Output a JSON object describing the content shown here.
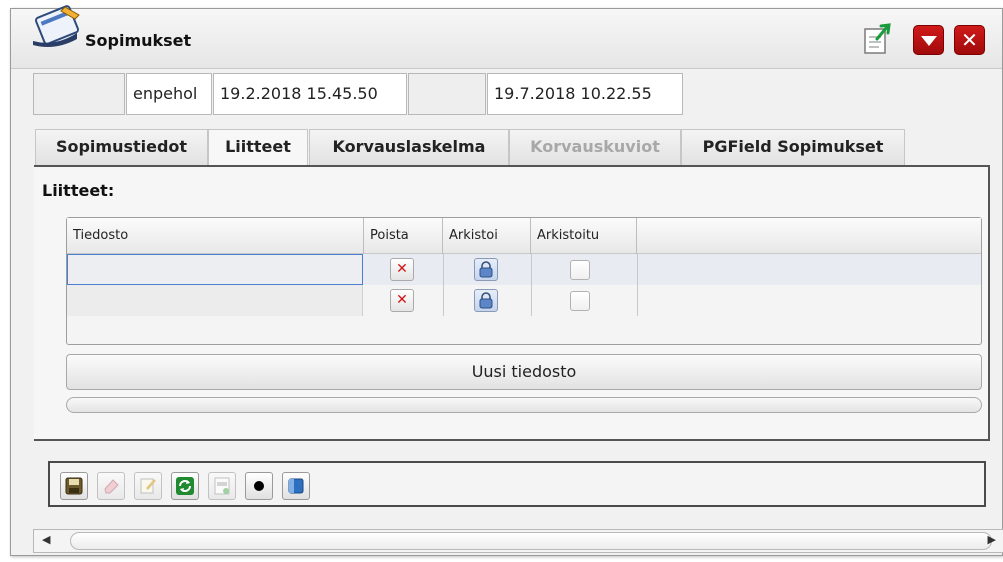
{
  "window": {
    "title": "Sopimukset"
  },
  "header": {
    "user": "enpehol",
    "created": "19.2.2018 15.45.50",
    "modified": "19.7.2018 10.22.55"
  },
  "tabs": [
    {
      "label": "Sopimustiedot",
      "active": false,
      "disabled": false
    },
    {
      "label": "Liitteet",
      "active": true,
      "disabled": false
    },
    {
      "label": "Korvauslaskelma",
      "active": false,
      "disabled": false
    },
    {
      "label": "Korvauskuviot",
      "active": false,
      "disabled": true
    },
    {
      "label": "PGField Sopimukset",
      "active": false,
      "disabled": false
    }
  ],
  "attachments": {
    "section_label": "Liitteet:",
    "columns": [
      "Tiedosto",
      "Poista",
      "Arkistoi",
      "Arkistoitu"
    ],
    "rows": [
      {
        "file": "",
        "archived": false
      },
      {
        "file": "",
        "archived": false
      }
    ],
    "new_file_label": "Uusi tiedosto"
  },
  "icons": {
    "app": "contracts-app-icon",
    "export": "export-document-icon",
    "minimize": "chevron-down-icon",
    "close": "close-icon",
    "delete": "delete-x-icon",
    "archive": "archive-icon",
    "toolbar": [
      "save-icon",
      "eraser-icon",
      "edit-document-icon",
      "refresh-icon",
      "xml-export-icon",
      "record-icon",
      "info-icon"
    ]
  },
  "colors": {
    "accent_red": "#c0121a",
    "selection_blue": "#4a7fd0"
  }
}
